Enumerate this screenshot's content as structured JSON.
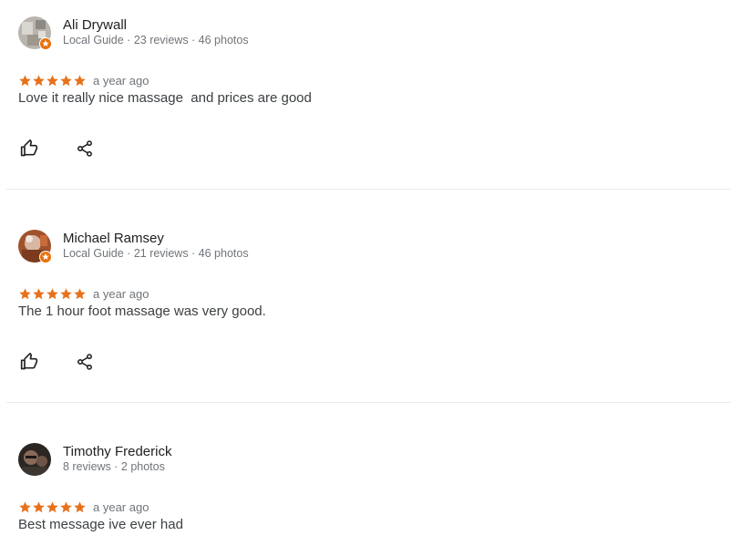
{
  "colors": {
    "star": "#e7711b",
    "badge": "#e8710a",
    "name": "#202124",
    "meta": "#70757a",
    "text": "#3c4043",
    "divider": "#e8eaed"
  },
  "icons": {
    "star": "star-icon",
    "like": "thumbs-up-icon",
    "share": "share-icon",
    "badge": "local-guide-badge-icon"
  },
  "reviews": [
    {
      "name": "Ali Drywall",
      "meta": "Local Guide · 23 reviews · 46 photos",
      "rating": 5,
      "date": "a year ago",
      "text": "Love it really nice massage  and prices are good",
      "local_guide": true
    },
    {
      "name": "Michael Ramsey",
      "meta": "Local Guide · 21 reviews · 46 photos",
      "rating": 5,
      "date": "a year ago",
      "text": "The 1 hour foot massage was very good.",
      "local_guide": true
    },
    {
      "name": "Timothy Frederick",
      "meta": "8 reviews · 2 photos",
      "rating": 5,
      "date": "a year ago",
      "text": "Best message ive ever had",
      "local_guide": false
    }
  ]
}
